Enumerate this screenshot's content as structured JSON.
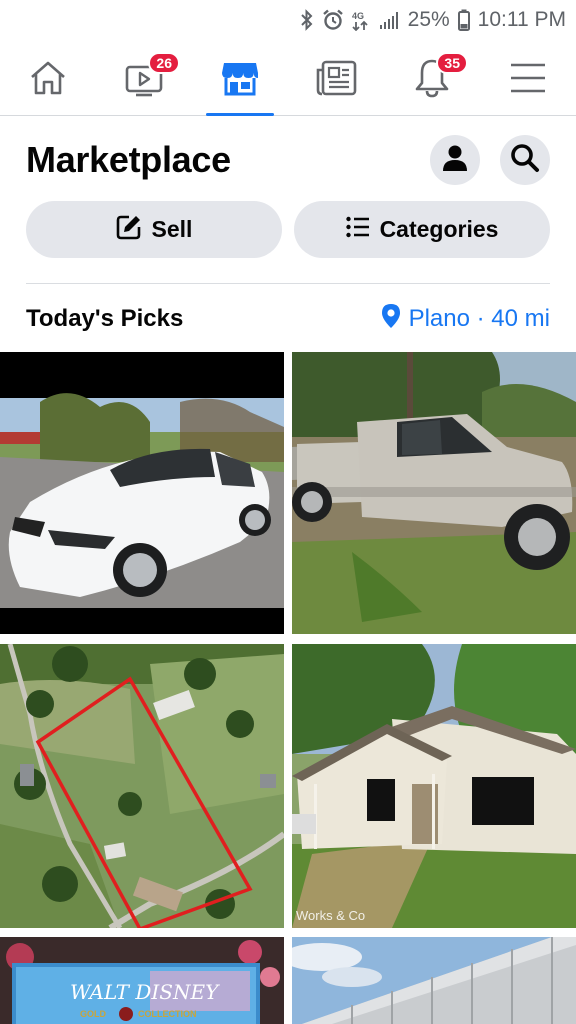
{
  "status_bar": {
    "battery": "25%",
    "time": "10:11 PM",
    "icons": [
      "bluetooth-icon",
      "alarm-icon",
      "data-icon",
      "signal-icon",
      "battery-icon"
    ]
  },
  "nav": {
    "items": [
      {
        "name": "home-icon",
        "badge": null,
        "active": false
      },
      {
        "name": "watch-icon",
        "badge": "26",
        "active": false
      },
      {
        "name": "marketplace-icon",
        "badge": null,
        "active": true
      },
      {
        "name": "news-icon",
        "badge": null,
        "active": false
      },
      {
        "name": "notifications-icon",
        "badge": "35",
        "active": false
      },
      {
        "name": "menu-icon",
        "badge": null,
        "active": false
      }
    ]
  },
  "header": {
    "title": "Marketplace",
    "profile_icon": "person-icon",
    "search_icon": "search-icon"
  },
  "actions": {
    "sell_label": "Sell",
    "categories_label": "Categories"
  },
  "picks": {
    "title": "Today's Picks",
    "location": "Plano · 40 mi",
    "listings": [
      {
        "name": "listing-white-sedan"
      },
      {
        "name": "listing-silver-pickup"
      },
      {
        "name": "listing-aerial-land"
      },
      {
        "name": "listing-white-house",
        "watermark": "Works & Co"
      },
      {
        "name": "listing-disney-vhs",
        "text_line1": "WALT DISNEY",
        "text_line2": "GOLD",
        "text_line3": "COLLECTION"
      },
      {
        "name": "listing-metal-building"
      }
    ]
  },
  "colors": {
    "accent": "#1877f2",
    "badge": "#e41e3f",
    "button_bg": "#e4e6eb"
  }
}
